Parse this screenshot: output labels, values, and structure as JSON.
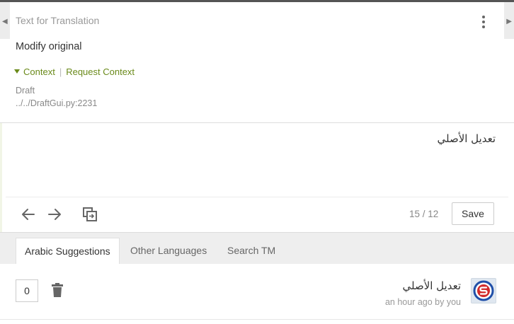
{
  "panel": {
    "title": "Text for Translation",
    "source_text": "Modify original",
    "context_label": "Context",
    "separator": "|",
    "request_context_label": "Request Context",
    "meta_line1": "Draft",
    "meta_line2": "../../DraftGui.py:2231"
  },
  "editor": {
    "translation_text": "تعديل الأصلي"
  },
  "toolbar": {
    "counter": "15 / 12",
    "save_label": "Save"
  },
  "tabs": [
    {
      "label": "Arabic Suggestions",
      "active": true
    },
    {
      "label": "Other Languages",
      "active": false
    },
    {
      "label": "Search TM",
      "active": false
    }
  ],
  "suggestion": {
    "votes": "0",
    "text": "تعديل الأصلي",
    "meta": "an hour ago by you"
  },
  "colors": {
    "accent": "#6a8a1a",
    "tabbar_bg": "#eeeeee",
    "avatar_red": "#d22b2b",
    "avatar_blue": "#1f4fa8"
  },
  "icons": {
    "prev": "arrow-left-icon",
    "next": "arrow-right-icon",
    "copy": "copy-original-icon",
    "menu": "kebab-menu-icon",
    "delete": "trash-icon",
    "avatar": "user-avatar"
  }
}
